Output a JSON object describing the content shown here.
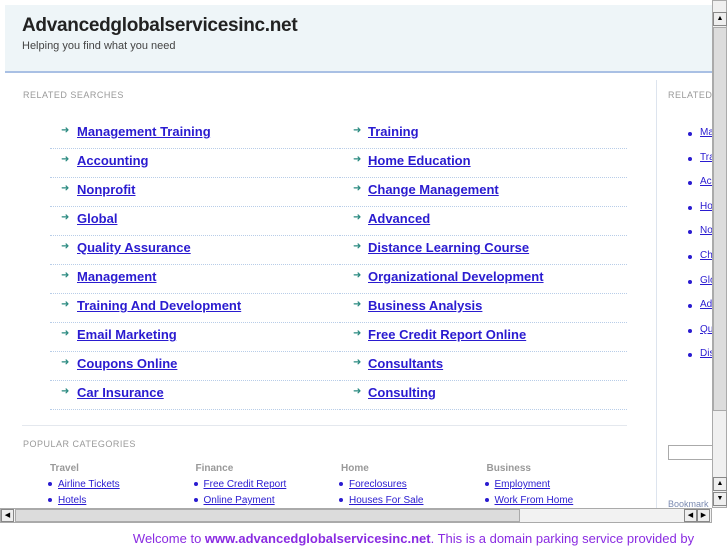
{
  "header": {
    "title": "Advancedglobalservicesinc.net",
    "tagline": "Helping you find what you need"
  },
  "related": {
    "label": "RELATED SEARCHES",
    "left": [
      "Management Training",
      "Accounting",
      "Nonprofit",
      "Global",
      "Quality Assurance",
      "Management",
      "Training And Development",
      "Email Marketing",
      "Coupons Online",
      "Car Insurance"
    ],
    "right": [
      "Training",
      "Home Education",
      "Change Management",
      "Advanced",
      "Distance Learning Course",
      "Organizational Development",
      "Business Analysis",
      "Free Credit Report Online",
      "Consultants",
      "Consulting"
    ]
  },
  "popular": {
    "label": "POPULAR CATEGORIES",
    "categories": [
      {
        "title": "Travel",
        "links": [
          "Airline Tickets",
          "Hotels"
        ]
      },
      {
        "title": "Finance",
        "links": [
          "Free Credit Report",
          "Online Payment"
        ]
      },
      {
        "title": "Home",
        "links": [
          "Foreclosures",
          "Houses For Sale"
        ]
      },
      {
        "title": "Business",
        "links": [
          "Employment",
          "Work From Home"
        ]
      }
    ]
  },
  "sidebar": {
    "label": "RELATED",
    "items": [
      "Ma",
      "Tra",
      "Acc",
      "Ho",
      "No",
      "Ch",
      "Glo",
      "Adv",
      "Qu",
      "Dis"
    ],
    "bookmark": "Bookmark"
  },
  "footer": {
    "pre": "Welcome to ",
    "domain": "www.advancedglobalservicesinc.net",
    "post": ". This is a domain parking service provided by"
  }
}
